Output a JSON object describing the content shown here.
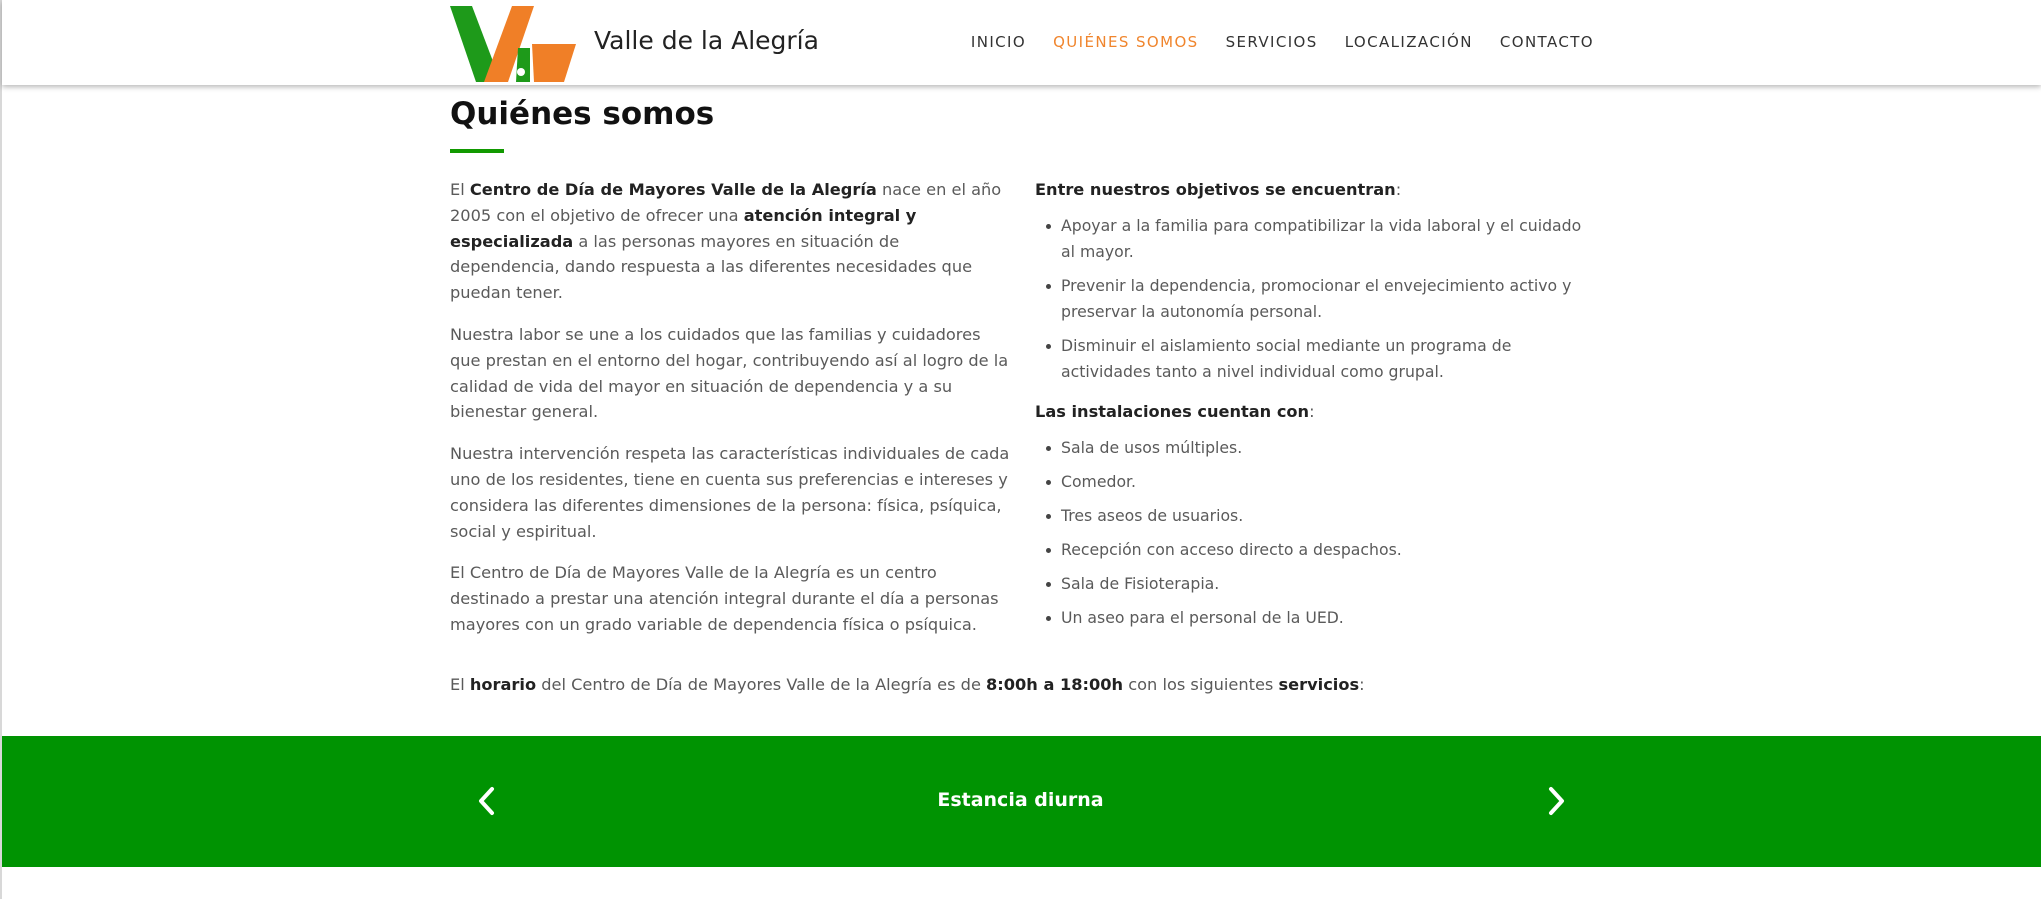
{
  "header": {
    "brand_name": "Valle de la Alegría",
    "logo_colors": {
      "green": "#1e9a1a",
      "orange": "#f07f27"
    }
  },
  "nav": {
    "items": [
      {
        "label": "INICIO",
        "active": false
      },
      {
        "label": "QUIÉNES SOMOS",
        "active": true
      },
      {
        "label": "SERVICIOS",
        "active": false
      },
      {
        "label": "LOCALIZACIÓN",
        "active": false
      },
      {
        "label": "CONTACTO",
        "active": false
      }
    ],
    "active_color": "#f0852d"
  },
  "main": {
    "title": "Quiénes somos",
    "accent_color": "#119900",
    "left_column": {
      "para1": {
        "t1": "El ",
        "b1": "Centro de Día de Mayores Valle de la Alegría",
        "t2": " nace en el año 2005 con el objetivo de ofrecer una ",
        "b2": "atención integral y especializada",
        "t3": " a las personas mayores en situación de dependencia, dando respuesta a las diferentes necesidades que puedan tener."
      },
      "para2": "Nuestra labor se une a los cuidados que las familias y cuidadores que prestan en el entorno del hogar, contribuyendo así al logro de la calidad de vida del mayor en situación de dependencia y a su bienestar general.",
      "para3": "Nuestra intervención respeta las características individuales de cada uno de los residentes, tiene en cuenta sus preferencias e intereses y considera las diferentes dimensiones de la persona: física, psíquica, social y espiritual.",
      "para4": "El Centro de Día de Mayores Valle de la Alegría es un centro destinado a prestar una atención integral durante el día a personas mayores con un grado variable de dependencia física o psíquica."
    },
    "right_column": {
      "objectives_heading": "Entre nuestros objetivos se encuentran",
      "objectives": [
        "Apoyar a la familia para compatibilizar la vida laboral y el cuidado al mayor.",
        "Prevenir la dependencia, promocionar el envejecimiento activo y preservar la autonomía personal.",
        "Disminuir el aislamiento social mediante un programa de actividades tanto a nivel individual como grupal."
      ],
      "facilities_heading": "Las instalaciones cuentan con",
      "facilities": [
        "Sala de usos múltiples.",
        "Comedor.",
        "Tres aseos de usuarios.",
        "Recepción con acceso directo a despachos.",
        "Sala de Fisioterapia.",
        "Un aseo para el personal de la UED."
      ]
    },
    "schedule": {
      "t1": "El ",
      "b1": "horario",
      "t2": " del Centro de Día de Mayores Valle de la Alegría es de ",
      "b2": "8:00h a 18:00h",
      "t3": " con los siguientes ",
      "b3": "servicios",
      "t4": ":"
    }
  },
  "slider": {
    "current_title": "Estancia diurna",
    "background_color": "#009302",
    "prev_icon": "chevron-left-icon",
    "next_icon": "chevron-right-icon"
  }
}
